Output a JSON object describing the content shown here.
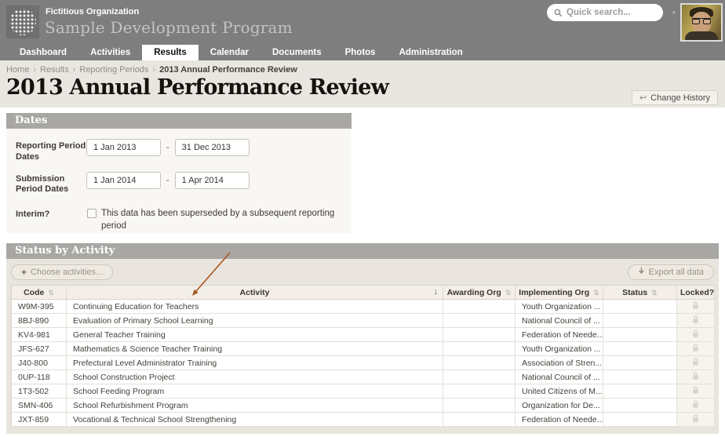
{
  "header": {
    "org_name": "Fictitious Organization",
    "program_name": "Sample Development Program",
    "search_placeholder": "Quick search...",
    "search_caret": "▾"
  },
  "nav": {
    "items": [
      {
        "label": "Dashboard",
        "active": false
      },
      {
        "label": "Activities",
        "active": false
      },
      {
        "label": "Results",
        "active": true
      },
      {
        "label": "Calendar",
        "active": false
      },
      {
        "label": "Documents",
        "active": false
      },
      {
        "label": "Photos",
        "active": false
      },
      {
        "label": "Administration",
        "active": false
      }
    ]
  },
  "breadcrumb": {
    "separator": "›",
    "items": [
      "Home",
      "Results",
      "Reporting Periods",
      "2013 Annual Performance Review"
    ]
  },
  "page": {
    "title": "2013 Annual Performance Review",
    "change_history_label": "Change History",
    "change_history_icon": "↩"
  },
  "dates_section": {
    "title": "Dates",
    "reporting_label": "Reporting Period Dates",
    "reporting_from": "1 Jan 2013",
    "reporting_to": "31 Dec 2013",
    "submission_label": "Submission Period Dates",
    "submission_from": "1 Jan 2014",
    "submission_to": "1 Apr 2014",
    "range_separator": "-",
    "interim_label": "Interim?",
    "interim_checked": false,
    "interim_checkbox_label": "This data has been superseded by a subsequent reporting period"
  },
  "status_section": {
    "title": "Status by Activity",
    "choose_button": "Choose activities...",
    "choose_icon": "+",
    "export_button": "Export all data",
    "sort_icon": "⇅",
    "activity_sort_icon": "↓",
    "columns": [
      "Code",
      "Activity",
      "Awarding Org",
      "Implementing Org",
      "Status",
      "Locked?"
    ],
    "rows": [
      {
        "code": "W9M-395",
        "activity": "Continuing Education for Teachers",
        "awarding_org": "",
        "implementing_org": "Youth Organization ...",
        "status": "",
        "locked": true
      },
      {
        "code": "8BJ-890",
        "activity": "Evaluation of Primary School Learning",
        "awarding_org": "",
        "implementing_org": "National Council of ...",
        "status": "",
        "locked": true
      },
      {
        "code": "KV4-981",
        "activity": "General Teacher Training",
        "awarding_org": "",
        "implementing_org": "Federation of Neede...",
        "status": "",
        "locked": true
      },
      {
        "code": "JFS-627",
        "activity": "Mathematics & Science Teacher Training",
        "awarding_org": "",
        "implementing_org": "Youth Organization ...",
        "status": "",
        "locked": true
      },
      {
        "code": "J40-800",
        "activity": "Prefectural Level Administrator Training",
        "awarding_org": "",
        "implementing_org": "Association of Stren...",
        "status": "",
        "locked": true
      },
      {
        "code": "0UP-118",
        "activity": "School Construction Project",
        "awarding_org": "",
        "implementing_org": "National Council of ...",
        "status": "",
        "locked": true
      },
      {
        "code": "1T3-502",
        "activity": "School Feeding Program",
        "awarding_org": "",
        "implementing_org": "United Citizens of M...",
        "status": "",
        "locked": true
      },
      {
        "code": "SMN-406",
        "activity": "School Refurbishment Program",
        "awarding_org": "",
        "implementing_org": "Organization for De...",
        "status": "",
        "locked": true
      },
      {
        "code": "JXT-859",
        "activity": "Vocational & Technical School Strengthening",
        "awarding_org": "",
        "implementing_org": "Federation of Neede...",
        "status": "",
        "locked": true
      }
    ]
  },
  "colors": {
    "header_gray": "#7e7e7e",
    "band_beige": "#e9e5e0",
    "panel_header_gray": "#a9a7a4",
    "dates_body": "#f8f7f4",
    "status_body": "#e9e5de",
    "annotation_arrow": "#a8541c"
  }
}
